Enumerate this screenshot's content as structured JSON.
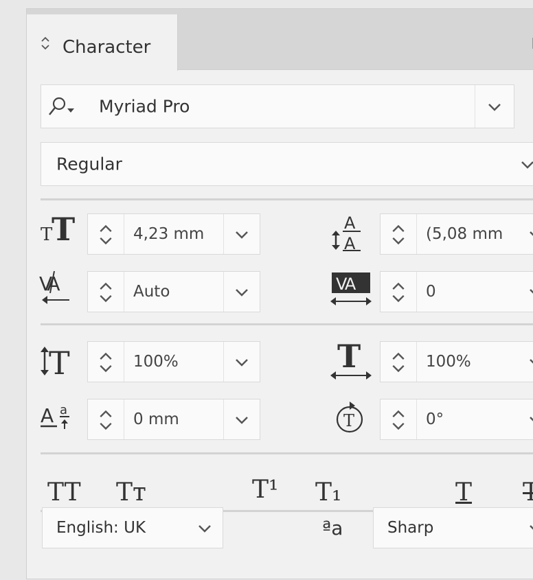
{
  "panel": {
    "tab_label": "Character"
  },
  "font": {
    "family": "Myriad Pro",
    "style": "Regular"
  },
  "metrics": {
    "font_size": "4,23 mm",
    "leading": "(5,08 mm",
    "kerning": "Auto",
    "tracking": "0",
    "vertical_scale": "100%",
    "horizontal_scale": "100%",
    "baseline_shift": "0 mm",
    "rotation": "0°"
  },
  "type_styles": {
    "all_caps": "TT",
    "small_caps": "Tт",
    "superscript": "T¹",
    "subscript": "T₁",
    "underline": "T",
    "strikethrough": "T"
  },
  "footer": {
    "language": "English: UK",
    "antialias_icon_text": "ªa",
    "antialias": "Sharp"
  },
  "icons": [
    "search-icon",
    "chevron-down-icon",
    "font-size-icon",
    "leading-icon",
    "kerning-icon",
    "tracking-icon",
    "vertical-scale-icon",
    "horizontal-scale-icon",
    "baseline-shift-icon",
    "rotation-icon",
    "panel-menu-icon"
  ]
}
